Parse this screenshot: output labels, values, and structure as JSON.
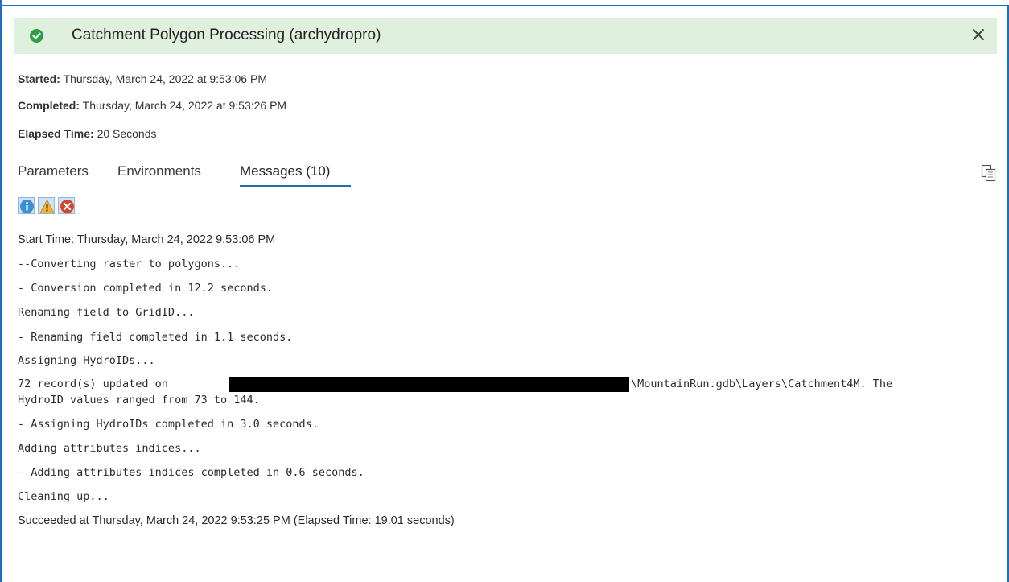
{
  "header": {
    "title": "Catchment Polygon Processing (archydropro)",
    "status_icon": "check-circle-icon",
    "close_icon": "close-icon",
    "status_color": "#2e9e47",
    "background_color": "#dff0df"
  },
  "meta": {
    "started_label": "Started:",
    "started_value": "Thursday, March 24, 2022 at 9:53:06 PM",
    "completed_label": "Completed:",
    "completed_value": "Thursday, March 24, 2022 at 9:53:26 PM",
    "elapsed_label": "Elapsed Time:",
    "elapsed_value": "20 Seconds"
  },
  "tabs": [
    {
      "label": "Parameters",
      "active": false
    },
    {
      "label": "Environments",
      "active": false
    },
    {
      "label": "Messages (10)",
      "active": true
    }
  ],
  "accent_color": "#1c6fb8",
  "filters": [
    {
      "icon": "info-icon",
      "color": "#3b8fd6"
    },
    {
      "icon": "warning-icon",
      "color": "#f2b531"
    },
    {
      "icon": "error-icon",
      "color": "#d8452f"
    }
  ],
  "copy_icon": "copy-icon",
  "messages": {
    "m0": "Start Time: Thursday, March 24, 2022 9:53:06 PM",
    "m1": "--Converting raster to polygons...",
    "m2": "- Conversion completed in 12.2 seconds.",
    "m3": "Renaming field to GridID...",
    "m4": "- Renaming field completed in 1.1 seconds.",
    "m5": "Assigning HydroIDs...",
    "m6a": "72 record(s) updated on",
    "m6b": "\\MountainRun.gdb\\Layers\\Catchment4M. The",
    "m6c": "HydroID values ranged from 73 to 144.",
    "m7": "- Assigning HydroIDs completed in 3.0 seconds.",
    "m8": "Adding attributes indices...",
    "m9": "- Adding attributes indices completed in 0.6 seconds.",
    "m10": "Cleaning up...",
    "m11": "Succeeded at Thursday, March 24, 2022 9:53:25 PM (Elapsed Time: 19.01 seconds)"
  }
}
